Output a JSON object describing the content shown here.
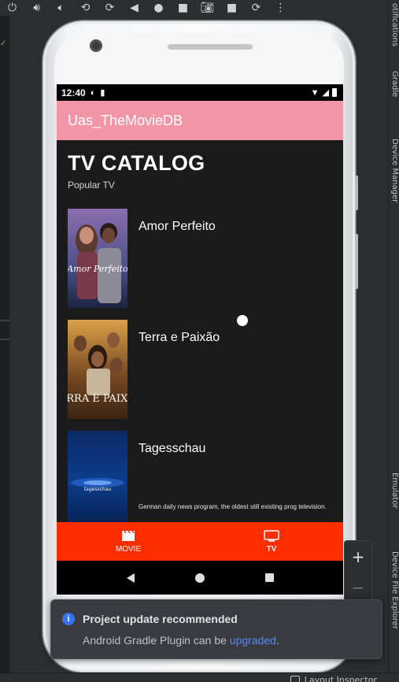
{
  "ide": {
    "toolbar_icons": [
      "power-icon",
      "volume-up-icon",
      "volume-down-icon",
      "rotate-left-icon",
      "rotate-right-icon",
      "back-icon",
      "home-icon",
      "overview-icon",
      "camera-icon",
      "video-icon",
      "snapshot-icon",
      "more-icon"
    ],
    "right_panels": [
      "otifications",
      "Gradle",
      "Device Manager",
      "Emulator",
      "Device File Explorer"
    ],
    "bottom_label": "Layout Inspector"
  },
  "status_bar": {
    "time": "12:40"
  },
  "app": {
    "title": "Uas_TheMovieDB",
    "heading": "TV CATALOG",
    "subheading": "Popular TV",
    "shows": [
      {
        "name": "Amor Perfeito",
        "poster_text": "Amor Perfeito",
        "description": ""
      },
      {
        "name": "Terra e Paixão",
        "poster_text": "TERRA E PAIXÃO",
        "description": ""
      },
      {
        "name": "Tagesschau",
        "poster_text": "tagesschau",
        "description": "German daily news program, the oldest still existing prog television."
      }
    ],
    "bottom_nav": [
      {
        "label": "MOVIE",
        "icon": "clapperboard-icon",
        "active": false
      },
      {
        "label": "TV",
        "icon": "tv-icon",
        "active": true
      }
    ]
  },
  "zoom": {
    "plus": "+",
    "minus": "−"
  },
  "notification": {
    "title": "Project update recommended",
    "body_prefix": "Android Gradle Plugin can be ",
    "link": "upgraded",
    "body_suffix": "."
  },
  "colors": {
    "app_bar": "#f295a7",
    "bottom_nav": "#ff2d00",
    "screen_bg": "#1b1b1c",
    "link": "#548af7"
  }
}
